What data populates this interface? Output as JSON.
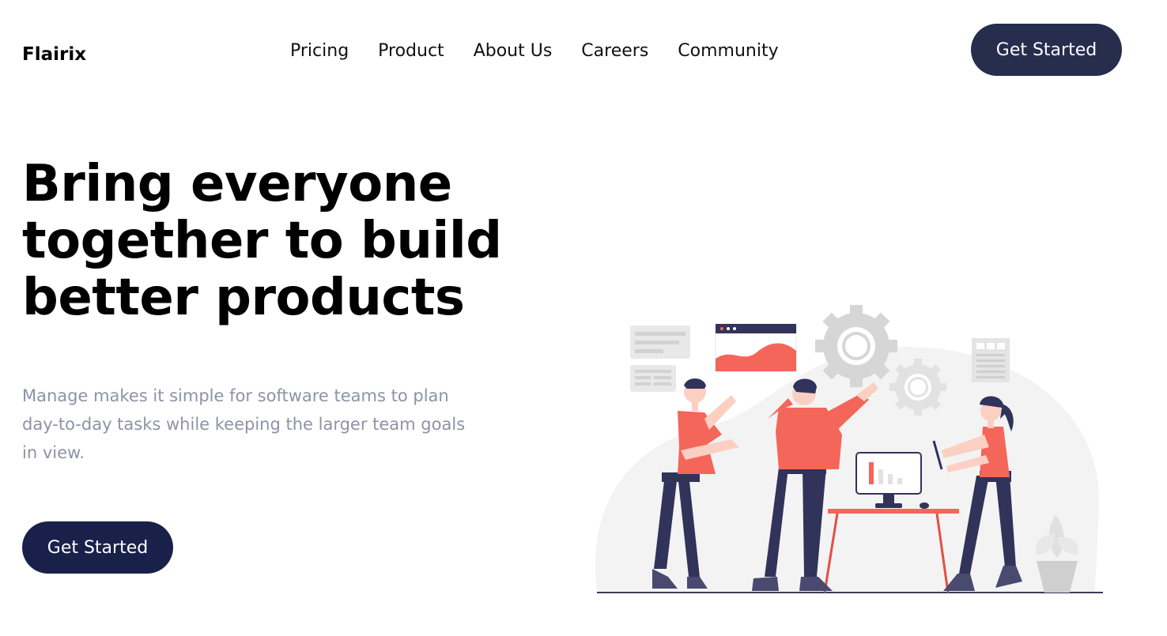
{
  "brand": {
    "name": "Flairix"
  },
  "nav": {
    "items": [
      {
        "label": "Pricing"
      },
      {
        "label": "Product"
      },
      {
        "label": "About Us"
      },
      {
        "label": "Careers"
      },
      {
        "label": "Community"
      }
    ]
  },
  "header": {
    "cta_label": "Get Started"
  },
  "hero": {
    "headline": "Bring everyone together to build better products",
    "subtext": "Manage makes it simple for software teams to plan day-to-day tasks while keeping the larger team goals in view.",
    "cta_label": "Get Started"
  },
  "colors": {
    "primary_dark": "#262d4d",
    "hero_button": "#19214b",
    "accent": "#f4665a",
    "muted_text": "#8d93a6"
  }
}
